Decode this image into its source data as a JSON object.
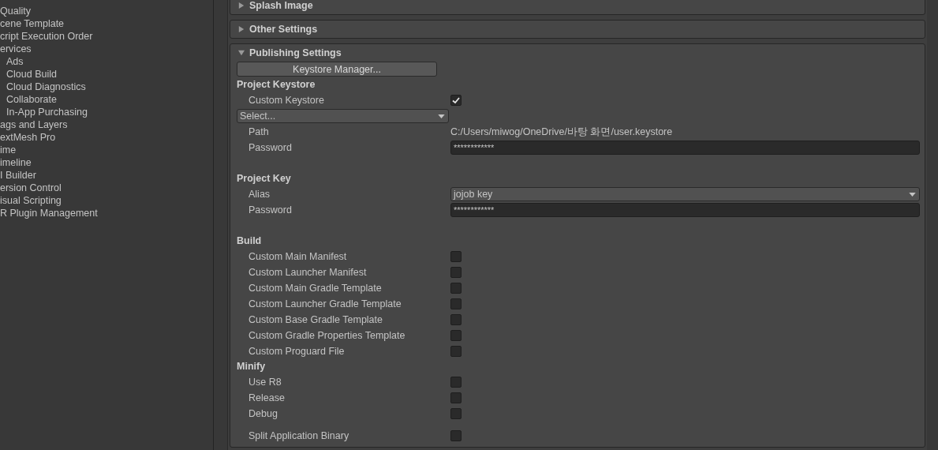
{
  "sidebar": {
    "items": [
      {
        "label": "Quality"
      },
      {
        "label": "cene Template"
      },
      {
        "label": "cript Execution Order"
      },
      {
        "label": "ervices",
        "children": [
          {
            "label": "Ads"
          },
          {
            "label": "Cloud Build"
          },
          {
            "label": "Cloud Diagnostics"
          },
          {
            "label": "Collaborate"
          },
          {
            "label": "In-App Purchasing"
          }
        ]
      },
      {
        "label": "ags and Layers"
      },
      {
        "label": "extMesh Pro"
      },
      {
        "label": "ime"
      },
      {
        "label": "imeline"
      },
      {
        "label": "I Builder"
      },
      {
        "label": "ersion Control"
      },
      {
        "label": "isual Scripting"
      },
      {
        "label": "R Plugin Management"
      }
    ]
  },
  "foldouts": [
    {
      "label": "Splash Image",
      "expanded": false
    },
    {
      "label": "Other Settings",
      "expanded": false
    },
    {
      "label": "Publishing Settings",
      "expanded": true,
      "keystore_manager_button": "Keystore Manager...",
      "groups": [
        {
          "heading": "Project Keystore",
          "rows": [
            {
              "kind": "checkbox",
              "label": "Custom Keystore",
              "checked": true
            },
            {
              "kind": "select",
              "value": "Select..."
            },
            {
              "kind": "text",
              "label": "Path",
              "value": "C:/Users/miwog/OneDrive/바탕 화면/user.keystore"
            },
            {
              "kind": "password",
              "label": "Password",
              "value": "************"
            }
          ]
        },
        {
          "heading": "Project Key",
          "rows": [
            {
              "kind": "dropdown",
              "label": "Alias",
              "value": "jojob key"
            },
            {
              "kind": "password",
              "label": "Password",
              "value": "************"
            }
          ]
        },
        {
          "heading": "Build",
          "rows": [
            {
              "kind": "checkbox",
              "label": "Custom Main Manifest",
              "checked": false
            },
            {
              "kind": "checkbox",
              "label": "Custom Launcher Manifest",
              "checked": false
            },
            {
              "kind": "checkbox",
              "label": "Custom Main Gradle Template",
              "checked": false
            },
            {
              "kind": "checkbox",
              "label": "Custom Launcher Gradle Template",
              "checked": false
            },
            {
              "kind": "checkbox",
              "label": "Custom Base Gradle Template",
              "checked": false
            },
            {
              "kind": "checkbox",
              "label": "Custom Gradle Properties Template",
              "checked": false
            },
            {
              "kind": "checkbox",
              "label": "Custom Proguard File",
              "checked": false
            }
          ]
        },
        {
          "heading": "Minify",
          "rows": [
            {
              "kind": "checkbox",
              "label": "Use R8",
              "checked": false
            },
            {
              "kind": "checkbox",
              "label": "Release",
              "checked": false
            },
            {
              "kind": "checkbox",
              "label": "Debug",
              "checked": false
            }
          ]
        },
        {
          "rows": [
            {
              "kind": "checkbox",
              "label": "Split Application Binary",
              "checked": false
            }
          ]
        }
      ]
    }
  ]
}
